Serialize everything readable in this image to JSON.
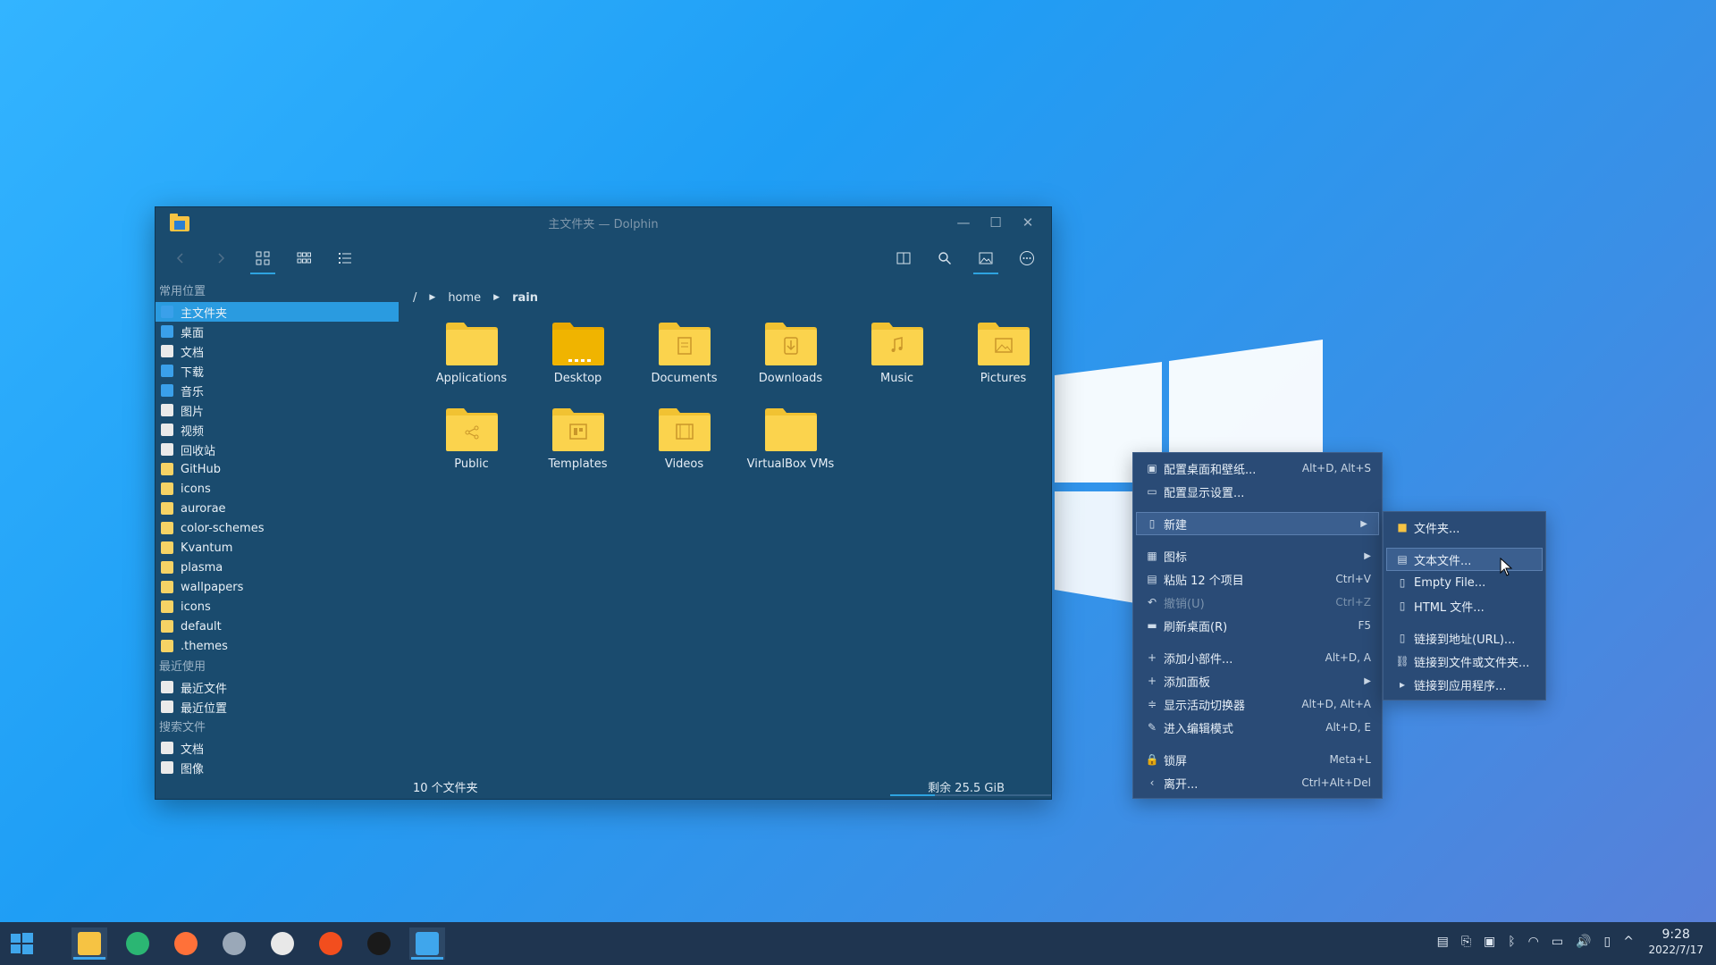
{
  "window": {
    "title": "主文件夹 — Dolphin",
    "minimize": "—",
    "maximize": "☐",
    "close": "✕"
  },
  "sidebar": {
    "places_title": "常用位置",
    "places": [
      {
        "label": "主文件夹",
        "icon": "computer-icon"
      },
      {
        "label": "桌面",
        "icon": "desktop-icon"
      },
      {
        "label": "文档",
        "icon": "document-icon"
      },
      {
        "label": "下载",
        "icon": "download-icon"
      },
      {
        "label": "音乐",
        "icon": "music-icon"
      },
      {
        "label": "图片",
        "icon": "image-icon"
      },
      {
        "label": "视频",
        "icon": "video-icon"
      },
      {
        "label": "回收站",
        "icon": "trash-icon"
      },
      {
        "label": "GitHub",
        "icon": "folder-icon"
      },
      {
        "label": "icons",
        "icon": "folder-icon"
      },
      {
        "label": "aurorae",
        "icon": "folder-icon"
      },
      {
        "label": "color-schemes",
        "icon": "folder-icon"
      },
      {
        "label": "Kvantum",
        "icon": "folder-icon"
      },
      {
        "label": "plasma",
        "icon": "folder-icon"
      },
      {
        "label": "wallpapers",
        "icon": "folder-icon"
      },
      {
        "label": "icons",
        "icon": "folder-icon"
      },
      {
        "label": "default",
        "icon": "folder-icon"
      },
      {
        "label": ".themes",
        "icon": "folder-icon"
      }
    ],
    "recent_title": "最近使用",
    "recent": [
      {
        "label": "最近文件",
        "icon": "recent-files-icon"
      },
      {
        "label": "最近位置",
        "icon": "recent-locations-icon"
      }
    ],
    "search_title": "搜索文件",
    "search": [
      {
        "label": "文档",
        "icon": "document-icon"
      },
      {
        "label": "图像",
        "icon": "image-icon"
      }
    ]
  },
  "breadcrumb": {
    "root": "/",
    "home": "home",
    "current": "rain"
  },
  "files": [
    {
      "name": "Applications",
      "emblem": ""
    },
    {
      "name": "Desktop",
      "emblem": "desktop"
    },
    {
      "name": "Documents",
      "emblem": "doc"
    },
    {
      "name": "Downloads",
      "emblem": "down"
    },
    {
      "name": "Music",
      "emblem": "music"
    },
    {
      "name": "Pictures",
      "emblem": "pic"
    },
    {
      "name": "Public",
      "emblem": "share"
    },
    {
      "name": "Templates",
      "emblem": "tmpl"
    },
    {
      "name": "Videos",
      "emblem": "video"
    },
    {
      "name": "VirtualBox VMs",
      "emblem": ""
    }
  ],
  "status": {
    "count": "10 个文件夹",
    "free": "剩余 25.5 GiB",
    "free_fraction": 0.28
  },
  "context_menu": {
    "items": [
      {
        "label": "配置桌面和壁纸...",
        "shortcut": "Alt+D, Alt+S",
        "icon": "wallpaper-icon"
      },
      {
        "label": "配置显示设置...",
        "shortcut": "",
        "icon": "display-icon"
      },
      {
        "label": "新建",
        "shortcut": "",
        "icon": "new-file-icon",
        "submenu": true
      },
      {
        "label": "图标",
        "shortcut": "",
        "icon": "icons-icon",
        "submenu": true
      },
      {
        "label": "粘贴 12 个项目",
        "shortcut": "Ctrl+V",
        "icon": "paste-icon"
      },
      {
        "label": "撤销(U)",
        "shortcut": "Ctrl+Z",
        "icon": "undo-icon",
        "disabled": true
      },
      {
        "label": "刷新桌面(R)",
        "shortcut": "F5",
        "icon": "refresh-icon"
      },
      {
        "label": "添加小部件...",
        "shortcut": "Alt+D, A",
        "icon": "plus-icon"
      },
      {
        "label": "添加面板",
        "shortcut": "",
        "icon": "plus-icon",
        "submenu": true
      },
      {
        "label": "显示活动切换器",
        "shortcut": "Alt+D, Alt+A",
        "icon": "activities-icon"
      },
      {
        "label": "进入编辑模式",
        "shortcut": "Alt+D, E",
        "icon": "edit-icon"
      },
      {
        "label": "锁屏",
        "shortcut": "Meta+L",
        "icon": "lock-icon"
      },
      {
        "label": "离开...",
        "shortcut": "Ctrl+Alt+Del",
        "icon": "leave-icon"
      }
    ]
  },
  "submenu": {
    "items": [
      {
        "label": "文件夹...",
        "icon": "folder-icon"
      },
      {
        "label": "文本文件...",
        "icon": "text-file-icon"
      },
      {
        "label": "Empty File...",
        "icon": "empty-file-icon"
      },
      {
        "label": "HTML 文件...",
        "icon": "html-file-icon"
      },
      {
        "label": "链接到地址(URL)...",
        "icon": "url-link-icon"
      },
      {
        "label": "链接到文件或文件夹...",
        "icon": "file-link-icon"
      },
      {
        "label": "链接到应用程序...",
        "icon": "app-link-icon"
      }
    ]
  },
  "taskbar": {
    "apps": [
      "dolphin-icon",
      "edge-dev-icon",
      "firefox-icon",
      "settings-icon",
      "github-icon",
      "figma-icon",
      "inkscape-icon",
      "remote-desktop-icon"
    ],
    "tray": [
      "▤",
      "⎘",
      "▣",
      "ᛒ",
      "◠",
      "▭",
      "🔊",
      "▯",
      "^"
    ],
    "time": "9:28",
    "date": "2022/7/17"
  }
}
